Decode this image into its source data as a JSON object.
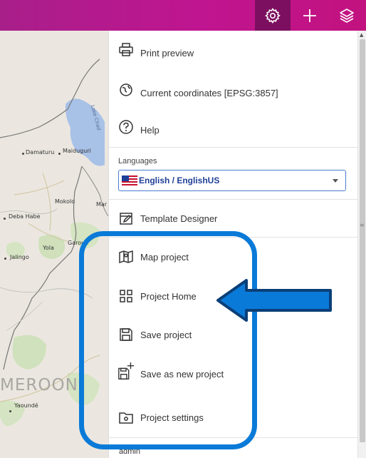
{
  "toolbar": {
    "settings_icon": "gear-icon",
    "add_icon": "plus-icon",
    "layers_icon": "layers-icon",
    "accent_color": "#c0158e",
    "active_color": "#7c0f5f"
  },
  "map": {
    "places": {
      "lake": "Lake Chad",
      "damaturu": "Damaturu",
      "maiduguri": "Maiduguri",
      "mokolo": "Mokolo",
      "mar": "Mar",
      "deba_habe": "Deba Habe",
      "yola": "Yola",
      "garoua": "Garoua",
      "jalingo": "Jalingo",
      "yaounde": "Yaoundé"
    },
    "country": "MEROON"
  },
  "menu": {
    "print_preview": "Print preview",
    "current_coordinates": "Current coordinates [EPSG:3857]",
    "help": "Help",
    "languages_label": "Languages",
    "language_value": "English / EnglishUS",
    "template_designer": "Template Designer",
    "map_project": "Map project",
    "project_home": "Project Home",
    "save_project": "Save project",
    "save_as_new_project": "Save as new project",
    "project_settings": "Project settings",
    "user": "admin"
  },
  "annotation": {
    "highlight_color": "#0a7ad8"
  }
}
